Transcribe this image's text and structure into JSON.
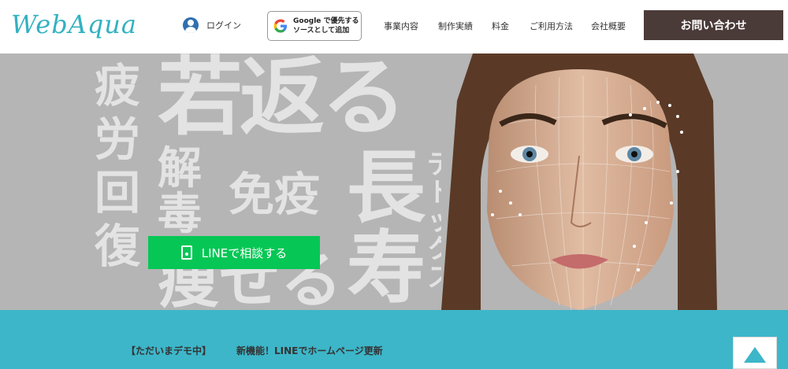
{
  "header": {
    "logo": "WebAqua",
    "login_label": "ログイン",
    "google_badge_line1": "Google で優先する",
    "google_badge_line2": "ソースとして追加",
    "nav": [
      {
        "label": "事業内容"
      },
      {
        "label": "制作実績"
      },
      {
        "label": "料金"
      },
      {
        "label": "ご利用方法"
      },
      {
        "label": "会社概要"
      }
    ],
    "contact_label": "お問い合わせ"
  },
  "hero": {
    "words": {
      "col1": [
        "疲",
        "労",
        "回",
        "復"
      ],
      "wakagaeru": "若返る",
      "gedoku": [
        "解",
        "毒"
      ],
      "meneki": "免疫",
      "chouju": [
        "長",
        "寿"
      ],
      "yaseru": "痩せる",
      "detox": [
        "デ",
        "ト",
        "ッ",
        "ク",
        "ス"
      ]
    },
    "line_button_label": "LINEで相談する"
  },
  "news": {
    "tag": "【ただいまデモ中】",
    "message": "新機能！LINEでホームページ更新"
  },
  "colors": {
    "accent": "#3db6c9",
    "logo": "#33b1c1",
    "contact_bg": "#4a3a38",
    "line_green": "#06c755",
    "hero_bg": "#b5b5b5"
  }
}
